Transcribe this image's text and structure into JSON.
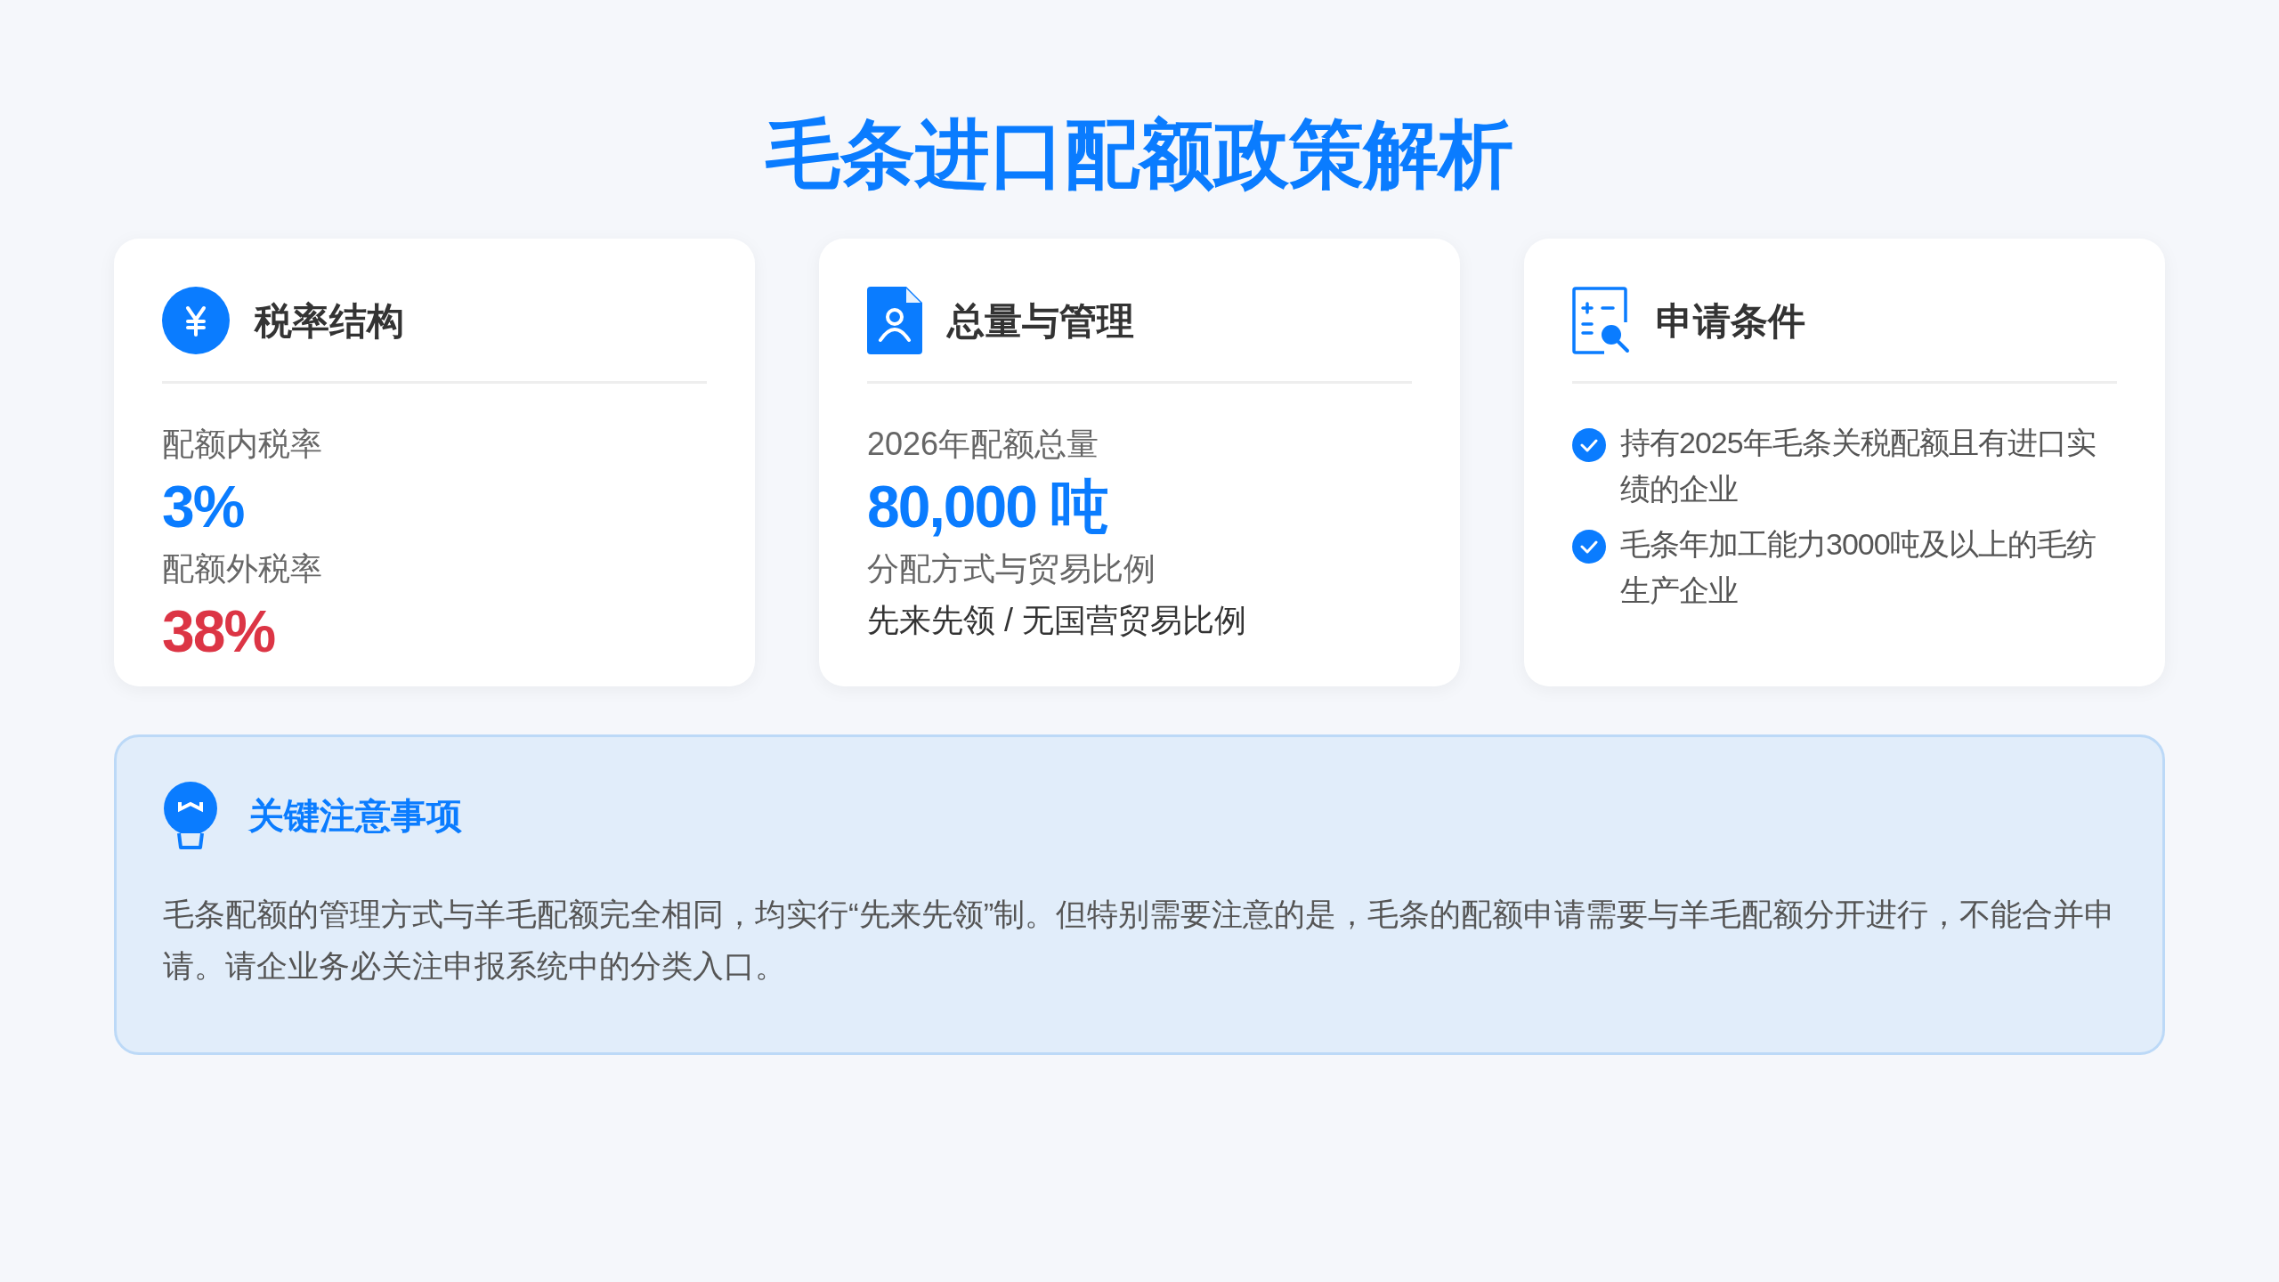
{
  "title": "毛条进口配额政策解析",
  "cards": [
    {
      "kind": "rates",
      "heading": "税率结构",
      "items": [
        {
          "kind": "metric",
          "label": "配额内税率",
          "value": "3%",
          "color": "#0a7cff"
        },
        {
          "kind": "metric",
          "label": "配额外税率",
          "value": "38%",
          "color": "#dc3545"
        }
      ]
    },
    {
      "kind": "quota",
      "heading": "总量与管理",
      "items": [
        {
          "kind": "metric",
          "label": "2026年配额总量",
          "value": "80,000 吨",
          "color": "#0a7cff"
        },
        {
          "kind": "text",
          "label": "分配方式与贸易比例",
          "value": "先来先领 / 无国营贸易比例"
        }
      ]
    },
    {
      "kind": "checklist",
      "heading": "申请条件",
      "list": [
        "持有2025年毛条关税配额且有进口实绩的企业",
        "毛条年加工能力3000吨及以上的毛纺生产企业"
      ]
    }
  ],
  "note": {
    "heading": "关键注意事项",
    "text": "毛条配额的管理方式与羊毛配额完全相同，均实行“先来先领”制。但特别需要注意的是，毛条的配额申请需要与羊毛配额分开进行，不能合并申请。请企业务必关注申报系统中的分类入口。"
  }
}
